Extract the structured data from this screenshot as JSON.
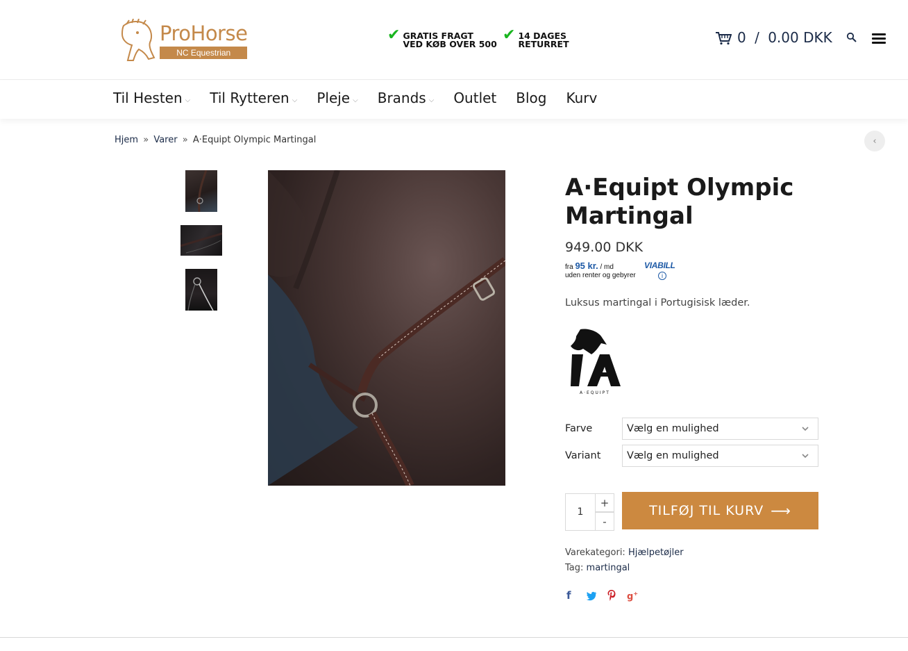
{
  "header": {
    "logo": {
      "name": "ProHorse",
      "subtitle": "NC Equestrian"
    },
    "usps": [
      {
        "line1": "GRATIS FRAGT",
        "line2": "VED KØB OVER 500"
      },
      {
        "line1": "14 DAGES",
        "line2": "RETURRET"
      }
    ],
    "cart": {
      "count": "0",
      "separator": "/",
      "total": "0.00 DKK"
    }
  },
  "nav": {
    "items": [
      {
        "label": "Til Hesten",
        "has_dropdown": true
      },
      {
        "label": "Til Rytteren",
        "has_dropdown": true
      },
      {
        "label": "Pleje",
        "has_dropdown": true
      },
      {
        "label": "Brands",
        "has_dropdown": true
      },
      {
        "label": "Outlet",
        "has_dropdown": false
      },
      {
        "label": "Blog",
        "has_dropdown": false
      },
      {
        "label": "Kurv",
        "has_dropdown": false
      }
    ]
  },
  "breadcrumb": {
    "home": "Hjem",
    "sep": "»",
    "category": "Varer",
    "current": "A·Equipt Olympic Martingal"
  },
  "product": {
    "title": "A·Equipt Olympic Martingal",
    "price": "949.00 DKK",
    "viabill": {
      "from": "fra",
      "amount": "95 kr.",
      "per": "/ md",
      "note": "uden renter og gebyrer",
      "brand": "VIABILL"
    },
    "short_description": "Luksus martingal i Portugisisk læder.",
    "brand_logo_text": "A·EQUIPT",
    "variations": [
      {
        "label": "Farve",
        "placeholder": "Vælg en mulighed"
      },
      {
        "label": "Variant",
        "placeholder": "Vælg en mulighed"
      }
    ],
    "quantity": "1",
    "qty_plus": "+",
    "qty_minus": "-",
    "add_to_cart": "TILFØJ TIL KURV",
    "meta": {
      "category_label": "Varekategori:",
      "category_value": "Hjælpetøjler",
      "tag_label": "Tag:",
      "tag_value": "martingal"
    }
  },
  "colors": {
    "accent": "#cc8940",
    "logo_gold": "#c4894a",
    "link": "#1b2b48",
    "usp_check": "#19b51f"
  }
}
